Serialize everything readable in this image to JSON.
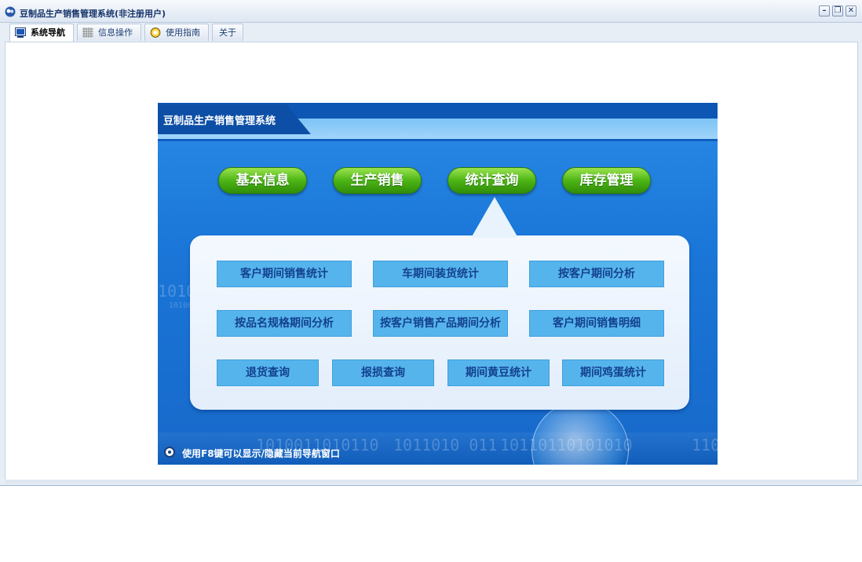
{
  "window": {
    "title": "豆制品生产销售管理系统(非注册用户)",
    "controls": [
      "–",
      "❐",
      "✕"
    ]
  },
  "tabs": [
    {
      "label": "系统导航",
      "icon": "monitor-icon",
      "active": true
    },
    {
      "label": "信息操作",
      "icon": "grid-icon",
      "active": false
    },
    {
      "label": "使用指南",
      "icon": "help-circle-icon",
      "active": false
    },
    {
      "label": "关于",
      "icon": "",
      "active": false
    }
  ],
  "panel": {
    "title": "豆制品生产销售管理系统",
    "main_buttons": [
      "基本信息",
      "生产销售",
      "统计查询",
      "库存管理"
    ],
    "sub_buttons": [
      "客户期间销售统计",
      "车期间装货统计",
      "按客户期间分析",
      "按品名规格期间分析",
      "按客户销售产品期间分析",
      "客户期间销售明细",
      "退货查询",
      "报损查询",
      "期间黄豆统计",
      "期间鸡蛋统计"
    ],
    "hint": "使用F8键可以显示/隐藏当前导航窗口"
  },
  "colors": {
    "accent_green": "#4db514",
    "panel_blue": "#1a76d8",
    "sub_button": "#56b4ec",
    "sub_button_text": "#13418e"
  }
}
